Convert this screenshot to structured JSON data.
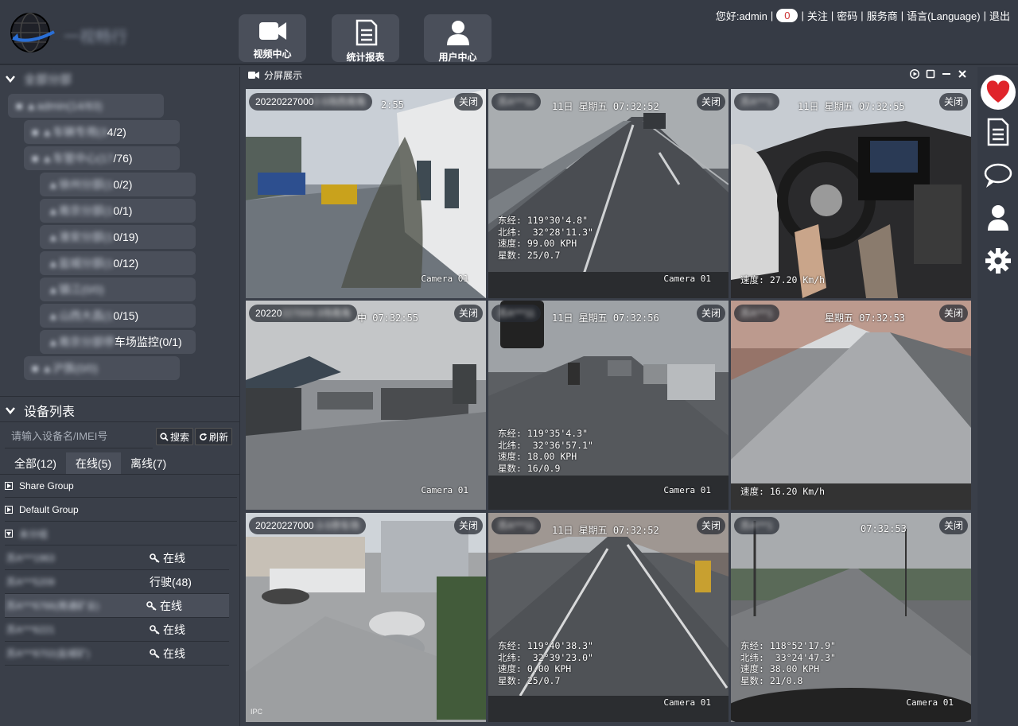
{
  "header": {
    "logo_text": "一视畅行",
    "nav": [
      {
        "label": "视频中心"
      },
      {
        "label": "统计报表"
      },
      {
        "label": "用户中心"
      }
    ],
    "greeting": "您好:admin",
    "notice_count": "0",
    "links": [
      "关注",
      "密码",
      "服务商",
      "语言(Language)",
      "退出"
    ]
  },
  "tree": {
    "root_label": "全部分部",
    "nodes": [
      {
        "name": "admin(14/83)",
        "count": ""
      },
      {
        "name": "车辆专用(3",
        "count": "4/2)"
      },
      {
        "name": "车管中心(17",
        "count": "/76)"
      },
      {
        "name": "徐州分部(1",
        "count": "0/2)"
      },
      {
        "name": "南京分部(1",
        "count": "0/1)"
      },
      {
        "name": "淮安分部(1",
        "count": "0/19)"
      },
      {
        "name": "盐城分部(1",
        "count": "0/12)"
      },
      {
        "name": "镇江(0/0)",
        "count": ""
      },
      {
        "name": "山西大昌(1",
        "count": "0/15)"
      },
      {
        "name": "南京分部停",
        "count": "车场监控(0/1)"
      },
      {
        "name": "沪族(0/0)",
        "count": ""
      }
    ]
  },
  "device_list": {
    "title": "设备列表",
    "search_placeholder": "请输入设备名/IMEI号",
    "search_btn": "搜索",
    "refresh_btn": "刷新",
    "tabs": [
      {
        "label": "全部(12)"
      },
      {
        "label": "在线(5)"
      },
      {
        "label": "离线(7)"
      }
    ],
    "groups": [
      "Share Group",
      "Default Group",
      "未分组"
    ],
    "devices": [
      {
        "name": "苏A***1963",
        "status": "在线"
      },
      {
        "name": "苏A***5209",
        "status": "行驶(48)"
      },
      {
        "name": "苏A***6766(南通矿业)",
        "status": "在线"
      },
      {
        "name": "苏A***6221",
        "status": "在线"
      },
      {
        "name": "苏A***8702(盐城矿)",
        "status": "在线"
      }
    ]
  },
  "video_panel": {
    "title": "分屏展示",
    "close_label": "关闭",
    "cells": [
      {
        "chip": "20220227000",
        "chip_blur": "2-5场西南角",
        "ts": "2:55",
        "osd": "",
        "cam": "Camera 01"
      },
      {
        "chip": "",
        "chip_blur": "苏A***11",
        "ts": "11日 星期五 07:32:52",
        "osd": "东经: 119°30'4.8\"\n北纬:  32°28'11.3\"\n速度: 99.00 KPH\n星数: 25/0.7",
        "cam": "Camera 01"
      },
      {
        "chip": "",
        "chip_blur": "苏A***1",
        "ts": "11日 星期五 07:32:55",
        "osd": "速度: 27.20 Km/h",
        "cam": ""
      },
      {
        "chip": "20220",
        "chip_blur": "227000-3场南角",
        "ts": "中 07:32:55",
        "osd": "",
        "cam": "Camera 01"
      },
      {
        "chip": "",
        "chip_blur": "苏A***11",
        "ts": "11日 星期五 07:32:56",
        "osd": "东经: 119°35'4.3\"\n北纬:  32°36'57.1\"\n速度: 18.00 KPH\n星数: 16/0.9",
        "cam": "Camera 01"
      },
      {
        "chip": "",
        "chip_blur": "苏A***1",
        "ts": "星期五 07:32:53",
        "osd": "速度: 16.20 Km/h",
        "cam": ""
      },
      {
        "chip": "20220227000",
        "chip_blur": "-3-5停车场",
        "ts": "",
        "osd": "",
        "cam": ""
      },
      {
        "chip": "",
        "chip_blur": "苏A***11",
        "ts": "11日 星期五 07:32:52",
        "osd": "东经: 119°40'38.3\"\n北纬:  32°39'23.0\"\n速度: 0.00 KPH\n星数: 25/0.7",
        "cam": "Camera 01"
      },
      {
        "chip": "",
        "chip_blur": "苏A***1",
        "ts": "07:32:53",
        "osd": "东经: 118°52'17.9\"\n北纬:  33°24'47.3\"\n速度: 38.00 KPH\n星数: 21/0.8",
        "cam": "Camera 01"
      }
    ],
    "ipc_label": "IPC"
  },
  "colors": {
    "bg": "#3a3f49",
    "header": "#363b45",
    "button": "#4a4f5a",
    "heart": "#e0242a"
  }
}
